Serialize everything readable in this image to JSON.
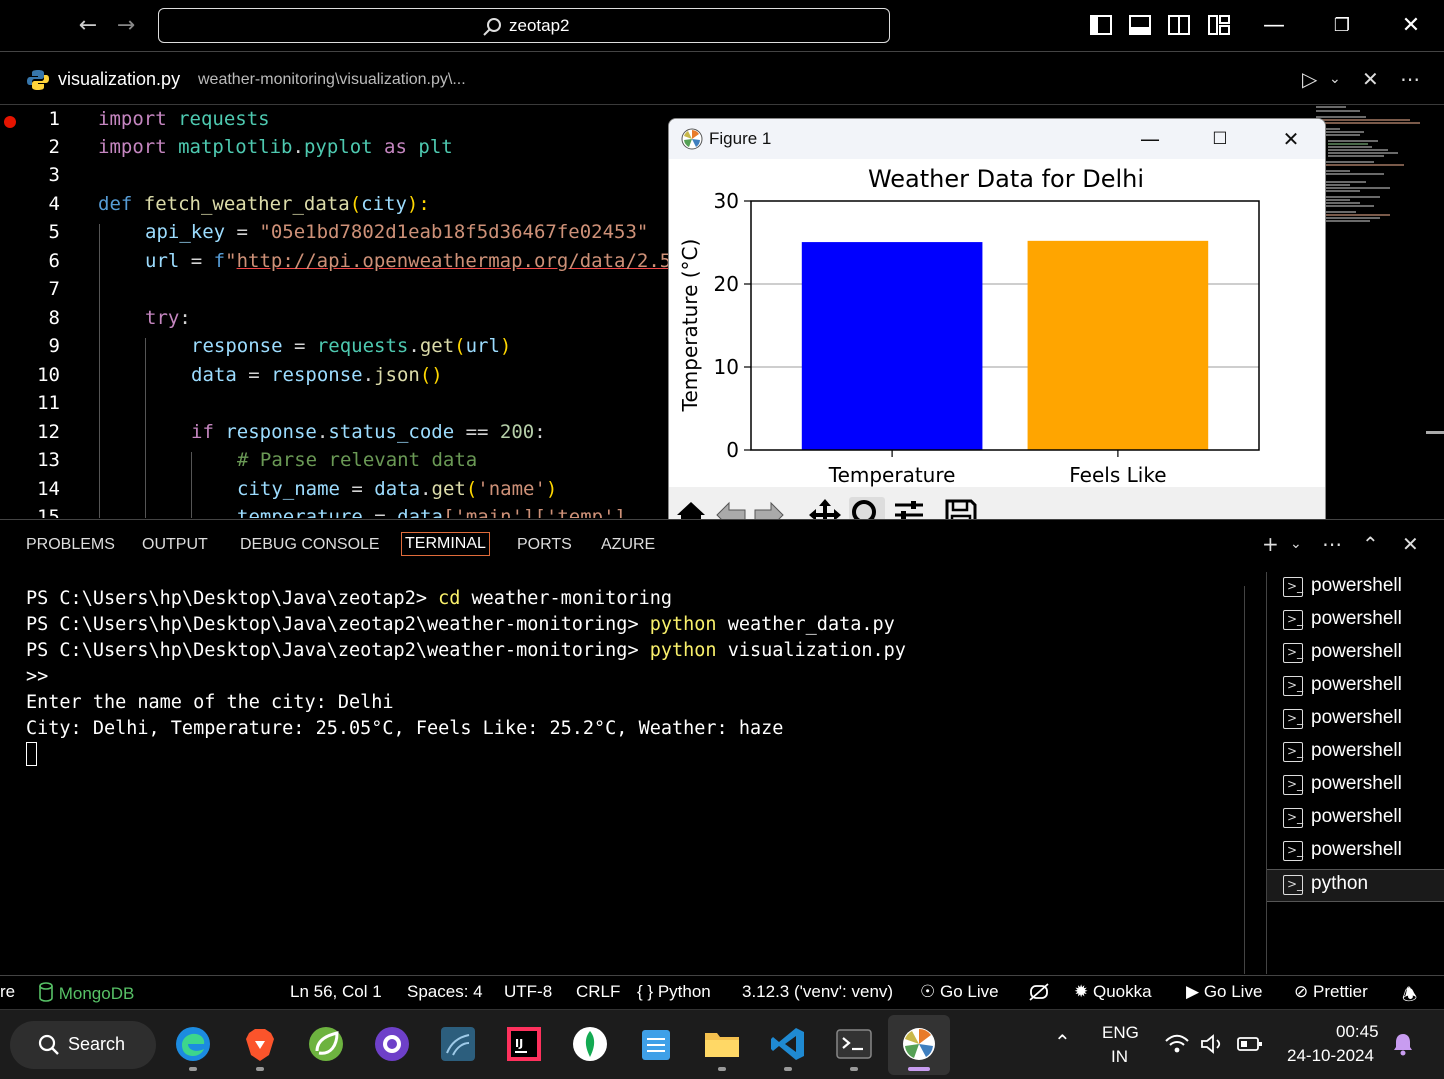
{
  "titlebar": {
    "search_text": "zeotap2"
  },
  "editor_header": {
    "file_name": "visualization.py",
    "file_path": "weather-monitoring\\visualization.py\\..."
  },
  "editor": {
    "line_numbers": [
      "1",
      "2",
      "3",
      "4",
      "5",
      "6",
      "7",
      "8",
      "9",
      "10",
      "11",
      "12",
      "13",
      "14",
      "15"
    ],
    "code": {
      "l1_kw": "import",
      "l1_mod": "requests",
      "l2_kw": "import",
      "l2_mod": "matplotlib",
      "l2_dot": ".",
      "l2_mod2": "pyplot",
      "l2_as": "as",
      "l2_alias": "plt",
      "l4_def": "def",
      "l4_fn": "fetch_weather_data",
      "l4_p1": "(",
      "l4_arg": "city",
      "l4_p2": "):",
      "l5_var": "api_key",
      "l5_eq": " = ",
      "l5_str": "\"05e1bd7802d1eab18f5d36467fe02453\"",
      "l6_var": "url",
      "l6_eq": " = ",
      "l6_f": "f",
      "l6_q": "\"",
      "l6_url": "http://api.openweathermap.org/data/2.5",
      "l8_kw": "try",
      "l8_colon": ":",
      "l9_var": "response",
      "l9_eq": " = ",
      "l9_mod": "requests",
      "l9_dot": ".",
      "l9_fn": "get",
      "l9_p1": "(",
      "l9_arg": "url",
      "l9_p2": ")",
      "l10_var": "data",
      "l10_eq": " = ",
      "l10_obj": "response",
      "l10_dot": ".",
      "l10_fn": "json",
      "l10_p": "()",
      "l12_kw": "if",
      "l12_obj": "response",
      "l12_dot": ".",
      "l12_attr": "status_code",
      "l12_op": " == ",
      "l12_num": "200",
      "l12_colon": ":",
      "l13_cm": "# Parse relevant data",
      "l14_var": "city_name",
      "l14_eq": " = ",
      "l14_obj": "data",
      "l14_dot": ".",
      "l14_fn": "get",
      "l14_p1": "(",
      "l14_str": "'name'",
      "l14_p2": ")",
      "l15_var": "temperature",
      "l15_eq": " = ",
      "l15_obj": "data",
      "l15_rest": "['main']['temp']"
    }
  },
  "figure": {
    "window_title": "Figure 1"
  },
  "chart_data": {
    "type": "bar",
    "title": "Weather Data for Delhi",
    "categories": [
      "Temperature",
      "Feels Like"
    ],
    "values": [
      25.05,
      25.2
    ],
    "colors": [
      "#0000ff",
      "#ffa500"
    ],
    "xlabel": "",
    "ylabel": "Temperature (°C)",
    "ylim": [
      0,
      30
    ],
    "yticks": [
      0,
      10,
      20,
      30
    ],
    "grid": "y"
  },
  "panel": {
    "tabs": [
      "PROBLEMS",
      "OUTPUT",
      "DEBUG CONSOLE",
      "TERMINAL",
      "PORTS",
      "AZURE"
    ],
    "active_tab": "TERMINAL"
  },
  "terminal": {
    "l1_prompt": "PS C:\\Users\\hp\\Desktop\\Java\\zeotap2> ",
    "l1_cmd": "cd",
    "l1_arg": " weather-monitoring",
    "l2_prompt": "PS C:\\Users\\hp\\Desktop\\Java\\zeotap2\\weather-monitoring> ",
    "l2_cmd": "python",
    "l2_arg": " weather_data.py",
    "l3_prompt": "PS C:\\Users\\hp\\Desktop\\Java\\zeotap2\\weather-monitoring> ",
    "l3_cmd": "python",
    "l3_arg": " visualization.py",
    "l4": ">>",
    "l5": "Enter the name of the city: Delhi",
    "l6": "City: Delhi, Temperature: 25.05°C, Feels Like: 25.2°C, Weather: haze"
  },
  "terminal_list": [
    "powershell",
    "powershell",
    "powershell",
    "powershell",
    "powershell",
    "powershell",
    "powershell",
    "powershell",
    "powershell",
    "python"
  ],
  "statusbar": {
    "left_cut": "re",
    "mongodb": "MongoDB",
    "position": "Ln 56, Col 1",
    "spaces": "Spaces: 4",
    "encoding": "UTF-8",
    "eol": "CRLF",
    "language_braces": "{ }",
    "language": "Python",
    "interpreter": "3.12.3 ('venv': venv)",
    "go_live_1": "Go Live",
    "quokka": "Quokka",
    "go_live_2": "Go Live",
    "prettier": "Prettier"
  },
  "taskbar": {
    "search_label": "Search",
    "lang_top": "ENG",
    "lang_bottom": "IN",
    "time": "00:45",
    "date": "24-10-2024"
  },
  "accent_colors": {
    "terminal_tab_border": "#e06c3b",
    "breakpoint": "#e51400",
    "mongodb": "#57c166"
  }
}
